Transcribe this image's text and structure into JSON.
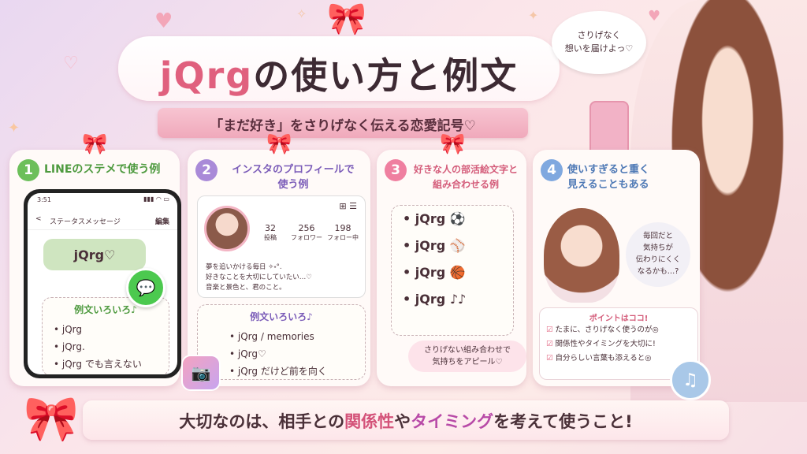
{
  "title": {
    "brand": "jQrg",
    "rest": "の使い方と例文"
  },
  "subtitle": "「まだ好き」をさりげなく伝える恋愛記号♡",
  "speech_bubble": {
    "line1": "さりげなく",
    "line2": "想いを届けよっ♡"
  },
  "card1": {
    "number": "1",
    "title": "LINEのステメで使う例",
    "phone": {
      "time": "3:51",
      "status_icons": "▮▮▮ ◠ ▭",
      "back": "<",
      "header": "ステータスメッセージ",
      "edit": "編集",
      "message": "jQrg♡"
    },
    "examples_head": "例文いろいろ♪",
    "examples": [
      "jQrg",
      "jQrg.",
      "jQrg でも言えない"
    ]
  },
  "card2": {
    "number": "2",
    "title": "インスタのプロフィールで\n使う例",
    "profile_icons": "⊞ ☰",
    "stats": [
      {
        "value": "32",
        "label": "投稿"
      },
      {
        "value": "256",
        "label": "フォロワー"
      },
      {
        "value": "198",
        "label": "フォロー中"
      }
    ],
    "bio": [
      "夢を追いかける毎日 ✧˖°.",
      "好きなことを大切にしていたい…♡",
      "音楽と景色と、君のこと。"
    ],
    "examples_head": "例文いろいろ♪",
    "examples": [
      "jQrg / memories",
      "jQrg♡",
      "jQrg だけど前を向く"
    ]
  },
  "card3": {
    "number": "3",
    "title": "好きな人の部活絵文字と\n組み合わせる例",
    "examples": [
      {
        "text": "jQrg",
        "emoji": "⚽"
      },
      {
        "text": "jQrg",
        "emoji": "⚾"
      },
      {
        "text": "jQrg",
        "emoji": "🏀"
      },
      {
        "text": "jQrg",
        "emoji": "♪♪"
      }
    ],
    "cta": {
      "line1": "さりげない組み合わせで",
      "line2": "気持ちをアピール♡"
    }
  },
  "card4": {
    "number": "4",
    "title": "使いすぎると重く\n見えることもある",
    "worry": {
      "line1": "毎回だと",
      "line2": "気持ちが",
      "line3": "伝わりにくく",
      "line4": "なるかも…?"
    },
    "points_head": "ポイントはココ!",
    "points": [
      "たまに、さりげなく使うのが◎",
      "関係性やタイミングを大切に!",
      "自分らしい言葉も添えると◎"
    ]
  },
  "bottom": {
    "part1": "大切なのは、相手との",
    "hl1": "関係性",
    "part2": "や",
    "hl2": "タイミング",
    "part3": "を考えて使うこと!"
  },
  "colors": {
    "accent": "#e0607e",
    "card1": "#6cbf5a",
    "card2": "#a98ad8",
    "card3": "#ef7fa0",
    "card4": "#7fa8df"
  }
}
